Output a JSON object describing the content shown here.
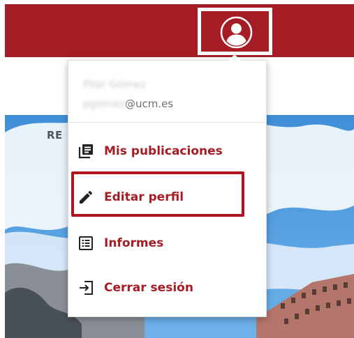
{
  "header": {
    "profile_icon": "user-circle-icon"
  },
  "page": {
    "section_label": "RE"
  },
  "user_menu": {
    "user_name": "Pilar Gómez",
    "email_local": "pgomez",
    "email_domain": "@ucm.es",
    "items": [
      {
        "label": "Mis publicaciones",
        "icon": "publications-icon"
      },
      {
        "label": "Editar perfil",
        "icon": "pencil-icon"
      },
      {
        "label": "Informes",
        "icon": "list-icon"
      },
      {
        "label": "Cerrar sesión",
        "icon": "logout-icon"
      }
    ]
  },
  "colors": {
    "brand_red": "#a51c24",
    "highlight_border": "#b0151f",
    "icon_dark": "#222222",
    "menu_text_muted": "#6f6f6f"
  }
}
